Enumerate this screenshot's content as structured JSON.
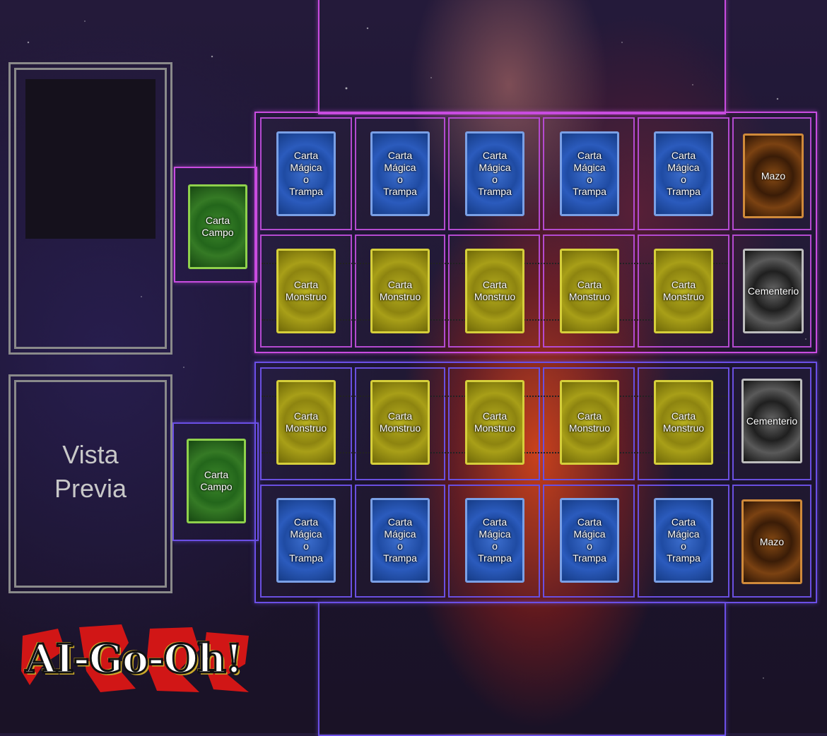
{
  "preview": {
    "title_line1": "Vista",
    "title_line2": "Previa"
  },
  "labels": {
    "spell": "Carta\nMágica\no\nTrampa",
    "monster": "Carta\nMonstruo",
    "field": "Carta\nCampo",
    "deck": "Mazo",
    "graveyard": "Cementerio"
  },
  "logo": {
    "text": "AI-Go-Oh!"
  },
  "colors": {
    "spell": "#2b5bbd",
    "monster": "#a89f18",
    "field": "#357a25",
    "deck": "#7b4212",
    "graveyard": "#5a5a5a",
    "zone_outline": "#b44ad0"
  }
}
